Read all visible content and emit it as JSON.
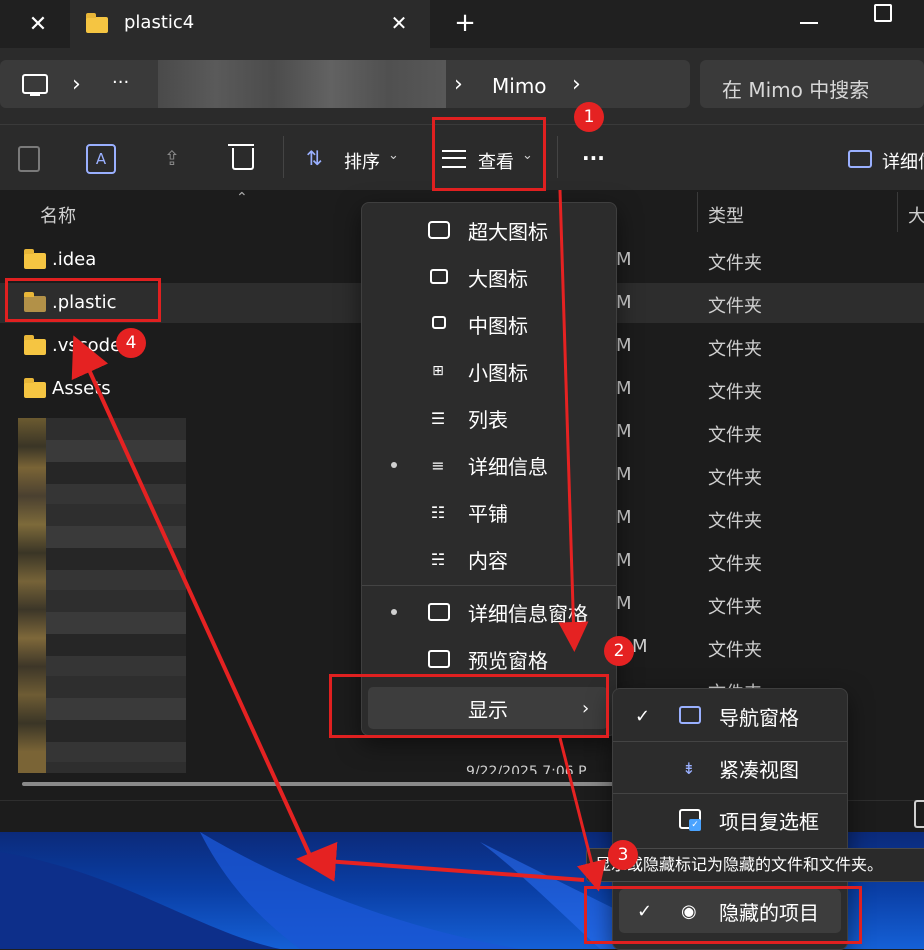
{
  "tabs": [
    {
      "label": "plastic4"
    }
  ],
  "tabbar": {
    "new_tab": "+"
  },
  "address": {
    "path_last": "Mimo",
    "overflow": "···",
    "sep": "›"
  },
  "search": {
    "placeholder": "在 Mimo 中搜索"
  },
  "toolbar": {
    "sort_label": "排序",
    "view_label": "查看",
    "more": "···",
    "details_label": "详细信"
  },
  "columns": {
    "name": "名称",
    "type": "类型",
    "size": "大"
  },
  "files": [
    {
      "name": ".idea",
      "date": "M",
      "type": "文件夹"
    },
    {
      "name": ".plastic",
      "date": "M",
      "type": "文件夹"
    },
    {
      "name": ".vscode",
      "date": "M",
      "type": "文件夹"
    },
    {
      "name": "Assets",
      "date": "M",
      "type": "文件夹"
    }
  ],
  "blurred_rows": [
    {
      "date": "M",
      "type": "文件夹"
    },
    {
      "date": "M",
      "type": "文件夹"
    },
    {
      "date": "M",
      "type": "文件夹"
    },
    {
      "date": "M",
      "type": "文件夹"
    },
    {
      "date": "M",
      "type": "文件夹"
    },
    {
      "date": "M",
      "type": "文件夹"
    },
    {
      "date": "M",
      "type": "文件夹"
    }
  ],
  "partial_date": "9/22/2025 7:06 P",
  "view_menu": {
    "items": [
      {
        "label": "超大图标",
        "icon": "extra-large-icons-icon"
      },
      {
        "label": "大图标",
        "icon": "large-icons-icon"
      },
      {
        "label": "中图标",
        "icon": "medium-icons-icon"
      },
      {
        "label": "小图标",
        "icon": "small-icons-icon"
      },
      {
        "label": "列表",
        "icon": "list-icon"
      },
      {
        "label": "详细信息",
        "icon": "details-icon",
        "selected": true
      },
      {
        "label": "平铺",
        "icon": "tiles-icon"
      },
      {
        "label": "内容",
        "icon": "content-icon"
      },
      {
        "label": "详细信息窗格",
        "icon": "details-pane-icon",
        "selected": true
      },
      {
        "label": "预览窗格",
        "icon": "preview-pane-icon"
      },
      {
        "label": "显示",
        "icon": "",
        "submenu": true
      }
    ]
  },
  "show_menu": {
    "items": [
      {
        "label": "导航窗格",
        "icon": "navigation-pane-icon",
        "checked": true
      },
      {
        "label": "紧凑视图",
        "icon": "compact-view-icon",
        "checked": false
      },
      {
        "label": "项目复选框",
        "icon": "item-checkbox-icon",
        "checked": false
      },
      {
        "label": "隐藏的项目",
        "icon": "eye-icon",
        "checked": true
      }
    ],
    "tooltip": "显示或隐藏标记为隐藏的文件和文件夹。"
  },
  "annotations": {
    "badges": [
      "1",
      "2",
      "3",
      "4"
    ]
  },
  "colors": {
    "accent": "#e02020",
    "folder": "#f5c542",
    "menu_bg": "#2c2c2c"
  }
}
